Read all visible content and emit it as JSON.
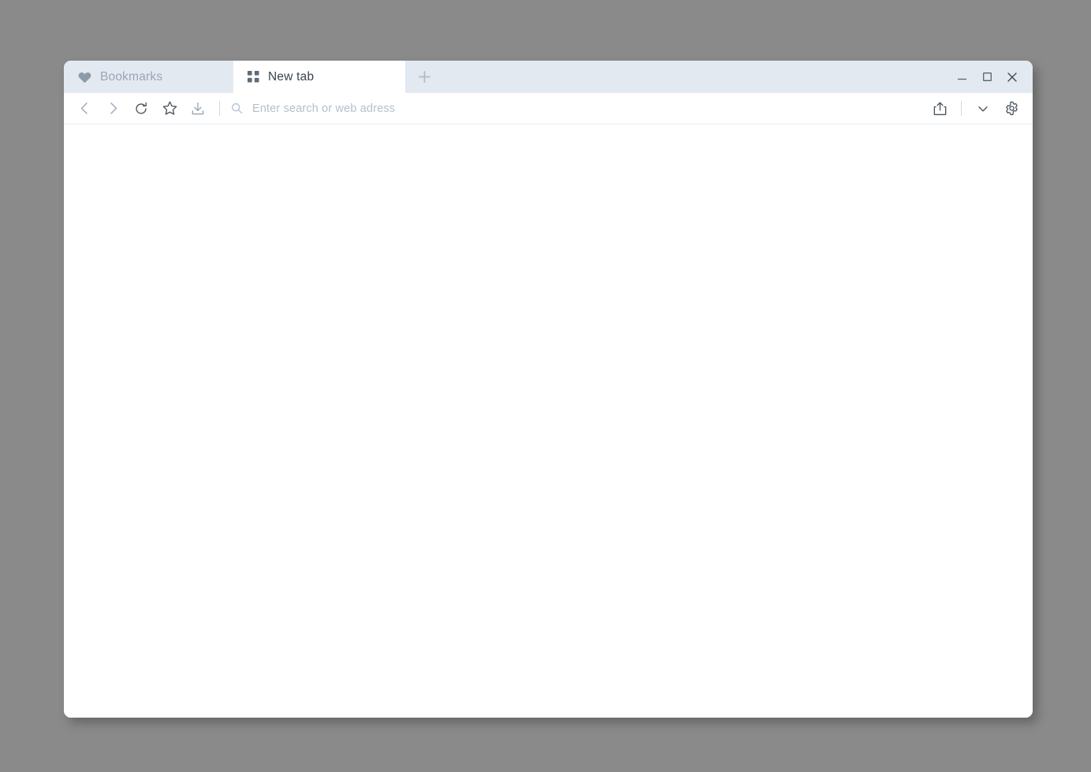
{
  "window": {
    "controls": {
      "minimize_label": "Minimize",
      "maximize_label": "Maximize",
      "close_label": "Close"
    }
  },
  "tabs": {
    "items": [
      {
        "label": "Bookmarks",
        "icon": "heart-icon",
        "active": false
      },
      {
        "label": "New tab",
        "icon": "grid-icon",
        "active": true
      }
    ],
    "new_tab_label": "+"
  },
  "toolbar": {
    "back_label": "Back",
    "forward_label": "Forward",
    "reload_label": "Reload",
    "bookmark_label": "Bookmark",
    "download_label": "Downloads",
    "share_label": "Share",
    "more_label": "More",
    "settings_label": "Settings"
  },
  "search": {
    "value": "",
    "placeholder": "Enter search or web adress",
    "icon": "search-icon"
  },
  "colors": {
    "desktop_background": "#8a8a8a",
    "tab_strip": "#e3e9f1",
    "active_tab": "#ffffff",
    "inactive_tab_text": "#9aa7b4",
    "active_tab_text": "#3c444d",
    "icon_gray": "#8d9aa8",
    "placeholder": "#b4c0cd",
    "toolbar_icon": "#4a535c"
  },
  "page": {
    "content": ""
  }
}
